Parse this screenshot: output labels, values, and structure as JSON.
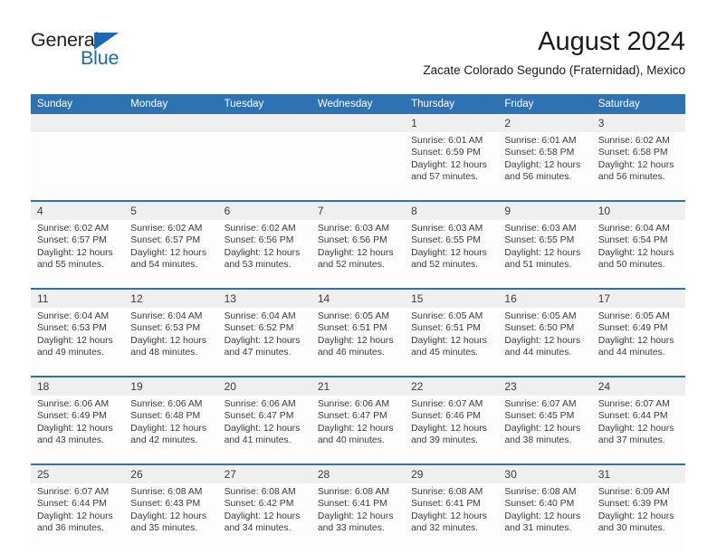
{
  "brand": {
    "name_part1": "General",
    "name_part2": "Blue",
    "triangle_color": "#1b6ab0",
    "accent_color": "#2e72b3"
  },
  "header": {
    "month_title": "August 2024",
    "location": "Zacate Colorado Segundo (Fraternidad), Mexico"
  },
  "calendar": {
    "weekday_headers": [
      "Sunday",
      "Monday",
      "Tuesday",
      "Wednesday",
      "Thursday",
      "Friday",
      "Saturday"
    ],
    "weeks": [
      {
        "days": [
          {
            "num": "",
            "sunrise": "",
            "sunset": "",
            "daylight1": "",
            "daylight2": ""
          },
          {
            "num": "",
            "sunrise": "",
            "sunset": "",
            "daylight1": "",
            "daylight2": ""
          },
          {
            "num": "",
            "sunrise": "",
            "sunset": "",
            "daylight1": "",
            "daylight2": ""
          },
          {
            "num": "",
            "sunrise": "",
            "sunset": "",
            "daylight1": "",
            "daylight2": ""
          },
          {
            "num": "1",
            "sunrise": "Sunrise: 6:01 AM",
            "sunset": "Sunset: 6:59 PM",
            "daylight1": "Daylight: 12 hours",
            "daylight2": "and 57 minutes."
          },
          {
            "num": "2",
            "sunrise": "Sunrise: 6:01 AM",
            "sunset": "Sunset: 6:58 PM",
            "daylight1": "Daylight: 12 hours",
            "daylight2": "and 56 minutes."
          },
          {
            "num": "3",
            "sunrise": "Sunrise: 6:02 AM",
            "sunset": "Sunset: 6:58 PM",
            "daylight1": "Daylight: 12 hours",
            "daylight2": "and 56 minutes."
          }
        ]
      },
      {
        "days": [
          {
            "num": "4",
            "sunrise": "Sunrise: 6:02 AM",
            "sunset": "Sunset: 6:57 PM",
            "daylight1": "Daylight: 12 hours",
            "daylight2": "and 55 minutes."
          },
          {
            "num": "5",
            "sunrise": "Sunrise: 6:02 AM",
            "sunset": "Sunset: 6:57 PM",
            "daylight1": "Daylight: 12 hours",
            "daylight2": "and 54 minutes."
          },
          {
            "num": "6",
            "sunrise": "Sunrise: 6:02 AM",
            "sunset": "Sunset: 6:56 PM",
            "daylight1": "Daylight: 12 hours",
            "daylight2": "and 53 minutes."
          },
          {
            "num": "7",
            "sunrise": "Sunrise: 6:03 AM",
            "sunset": "Sunset: 6:56 PM",
            "daylight1": "Daylight: 12 hours",
            "daylight2": "and 52 minutes."
          },
          {
            "num": "8",
            "sunrise": "Sunrise: 6:03 AM",
            "sunset": "Sunset: 6:55 PM",
            "daylight1": "Daylight: 12 hours",
            "daylight2": "and 52 minutes."
          },
          {
            "num": "9",
            "sunrise": "Sunrise: 6:03 AM",
            "sunset": "Sunset: 6:55 PM",
            "daylight1": "Daylight: 12 hours",
            "daylight2": "and 51 minutes."
          },
          {
            "num": "10",
            "sunrise": "Sunrise: 6:04 AM",
            "sunset": "Sunset: 6:54 PM",
            "daylight1": "Daylight: 12 hours",
            "daylight2": "and 50 minutes."
          }
        ]
      },
      {
        "days": [
          {
            "num": "11",
            "sunrise": "Sunrise: 6:04 AM",
            "sunset": "Sunset: 6:53 PM",
            "daylight1": "Daylight: 12 hours",
            "daylight2": "and 49 minutes."
          },
          {
            "num": "12",
            "sunrise": "Sunrise: 6:04 AM",
            "sunset": "Sunset: 6:53 PM",
            "daylight1": "Daylight: 12 hours",
            "daylight2": "and 48 minutes."
          },
          {
            "num": "13",
            "sunrise": "Sunrise: 6:04 AM",
            "sunset": "Sunset: 6:52 PM",
            "daylight1": "Daylight: 12 hours",
            "daylight2": "and 47 minutes."
          },
          {
            "num": "14",
            "sunrise": "Sunrise: 6:05 AM",
            "sunset": "Sunset: 6:51 PM",
            "daylight1": "Daylight: 12 hours",
            "daylight2": "and 46 minutes."
          },
          {
            "num": "15",
            "sunrise": "Sunrise: 6:05 AM",
            "sunset": "Sunset: 6:51 PM",
            "daylight1": "Daylight: 12 hours",
            "daylight2": "and 45 minutes."
          },
          {
            "num": "16",
            "sunrise": "Sunrise: 6:05 AM",
            "sunset": "Sunset: 6:50 PM",
            "daylight1": "Daylight: 12 hours",
            "daylight2": "and 44 minutes."
          },
          {
            "num": "17",
            "sunrise": "Sunrise: 6:05 AM",
            "sunset": "Sunset: 6:49 PM",
            "daylight1": "Daylight: 12 hours",
            "daylight2": "and 44 minutes."
          }
        ]
      },
      {
        "days": [
          {
            "num": "18",
            "sunrise": "Sunrise: 6:06 AM",
            "sunset": "Sunset: 6:49 PM",
            "daylight1": "Daylight: 12 hours",
            "daylight2": "and 43 minutes."
          },
          {
            "num": "19",
            "sunrise": "Sunrise: 6:06 AM",
            "sunset": "Sunset: 6:48 PM",
            "daylight1": "Daylight: 12 hours",
            "daylight2": "and 42 minutes."
          },
          {
            "num": "20",
            "sunrise": "Sunrise: 6:06 AM",
            "sunset": "Sunset: 6:47 PM",
            "daylight1": "Daylight: 12 hours",
            "daylight2": "and 41 minutes."
          },
          {
            "num": "21",
            "sunrise": "Sunrise: 6:06 AM",
            "sunset": "Sunset: 6:47 PM",
            "daylight1": "Daylight: 12 hours",
            "daylight2": "and 40 minutes."
          },
          {
            "num": "22",
            "sunrise": "Sunrise: 6:07 AM",
            "sunset": "Sunset: 6:46 PM",
            "daylight1": "Daylight: 12 hours",
            "daylight2": "and 39 minutes."
          },
          {
            "num": "23",
            "sunrise": "Sunrise: 6:07 AM",
            "sunset": "Sunset: 6:45 PM",
            "daylight1": "Daylight: 12 hours",
            "daylight2": "and 38 minutes."
          },
          {
            "num": "24",
            "sunrise": "Sunrise: 6:07 AM",
            "sunset": "Sunset: 6:44 PM",
            "daylight1": "Daylight: 12 hours",
            "daylight2": "and 37 minutes."
          }
        ]
      },
      {
        "days": [
          {
            "num": "25",
            "sunrise": "Sunrise: 6:07 AM",
            "sunset": "Sunset: 6:44 PM",
            "daylight1": "Daylight: 12 hours",
            "daylight2": "and 36 minutes."
          },
          {
            "num": "26",
            "sunrise": "Sunrise: 6:08 AM",
            "sunset": "Sunset: 6:43 PM",
            "daylight1": "Daylight: 12 hours",
            "daylight2": "and 35 minutes."
          },
          {
            "num": "27",
            "sunrise": "Sunrise: 6:08 AM",
            "sunset": "Sunset: 6:42 PM",
            "daylight1": "Daylight: 12 hours",
            "daylight2": "and 34 minutes."
          },
          {
            "num": "28",
            "sunrise": "Sunrise: 6:08 AM",
            "sunset": "Sunset: 6:41 PM",
            "daylight1": "Daylight: 12 hours",
            "daylight2": "and 33 minutes."
          },
          {
            "num": "29",
            "sunrise": "Sunrise: 6:08 AM",
            "sunset": "Sunset: 6:41 PM",
            "daylight1": "Daylight: 12 hours",
            "daylight2": "and 32 minutes."
          },
          {
            "num": "30",
            "sunrise": "Sunrise: 6:08 AM",
            "sunset": "Sunset: 6:40 PM",
            "daylight1": "Daylight: 12 hours",
            "daylight2": "and 31 minutes."
          },
          {
            "num": "31",
            "sunrise": "Sunrise: 6:09 AM",
            "sunset": "Sunset: 6:39 PM",
            "daylight1": "Daylight: 12 hours",
            "daylight2": "and 30 minutes."
          }
        ]
      }
    ]
  }
}
